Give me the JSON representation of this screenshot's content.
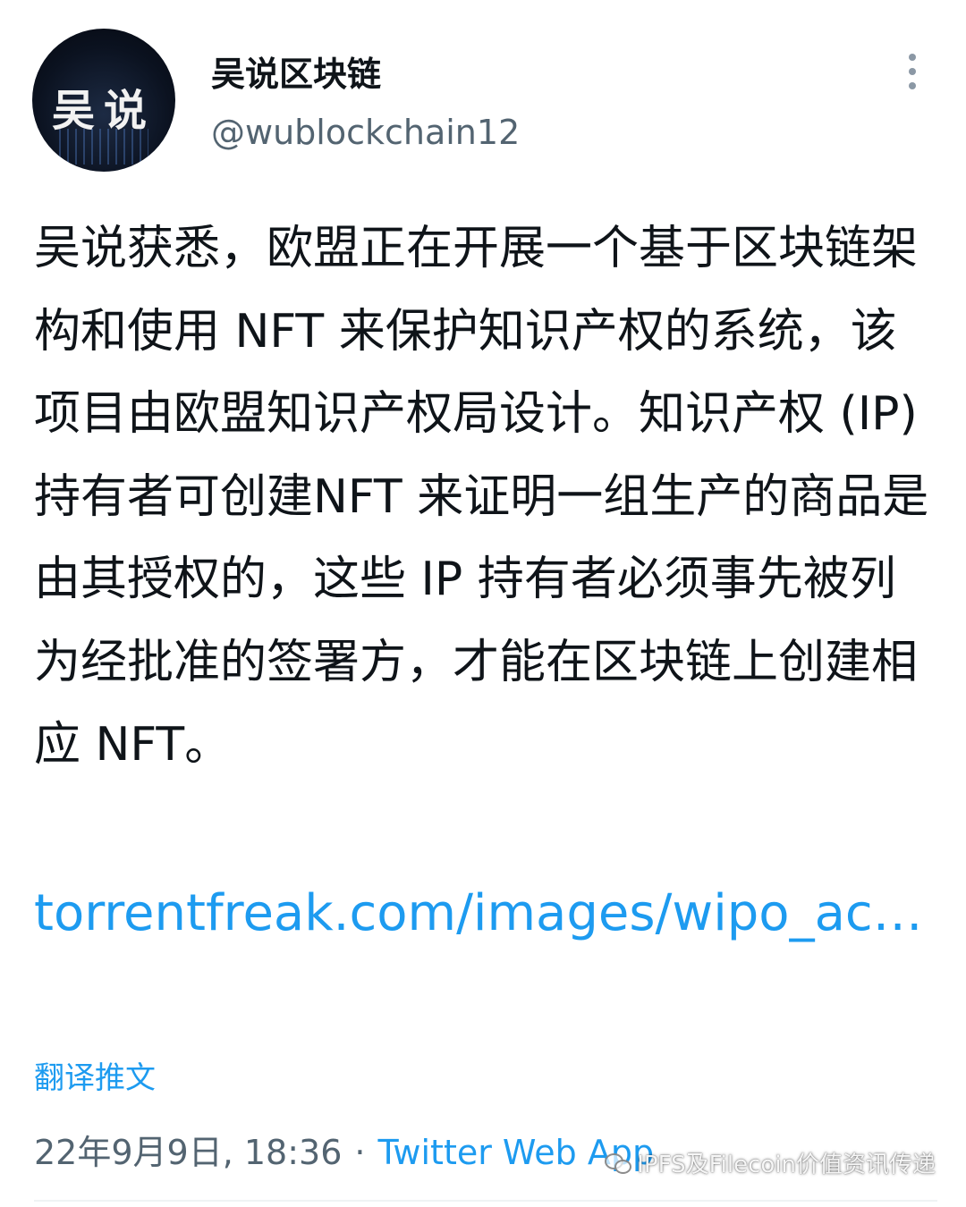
{
  "author": {
    "avatar_text": "吴说",
    "display_name": "吴说区块链",
    "handle": "@wublockchain12"
  },
  "tweet": {
    "text": "吴说获悉，欧盟正在开展一个基于区块链架构和使用 NFT 来保护知识产权的系统，该项目由欧盟知识产权局设计。知识产权 (IP) 持有者可创建NFT 来证明一组生产的商品是由其授权的，这些 IP 持有者必须事先被列为经批准的签署方，才能在区块链上创建相应 NFT。",
    "link_text": "torrentfreak.com/images/wipo_ac…",
    "translate_label": "翻译推文",
    "timestamp": "22年9月9日, 18:36",
    "separator": "·",
    "source": "Twitter Web App"
  },
  "watermark": {
    "text": "IPFS及Filecoin价值资讯传递"
  },
  "colors": {
    "link": "#1d9bf0",
    "secondary_text": "#536471",
    "primary_text": "#0f1419"
  },
  "icons": {
    "more": "more-vertical-icon",
    "watermark": "wechat-icon"
  }
}
